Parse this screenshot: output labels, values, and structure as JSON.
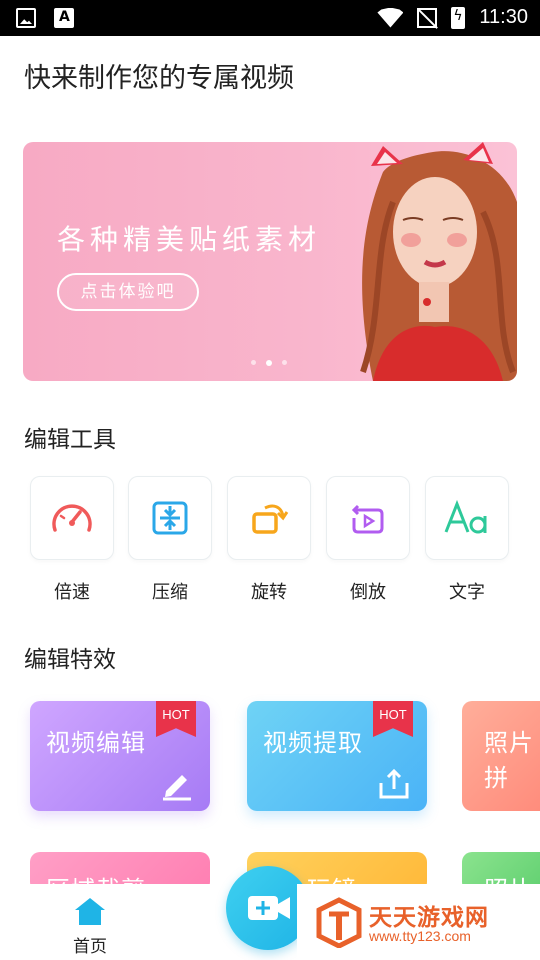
{
  "status_bar": {
    "time": "11:30",
    "icons": [
      "image-icon",
      "font-a-icon",
      "wifi-icon",
      "no-sim-icon",
      "battery-charging-icon"
    ]
  },
  "header": {
    "title": "快来制作您的专属视频"
  },
  "banner": {
    "headline": "各种精美贴纸素材",
    "button_label": "点击体验吧",
    "active_slide": 2,
    "slide_count": 3
  },
  "sections": {
    "tools_title": "编辑工具",
    "effects_title": "编辑特效"
  },
  "tools": [
    {
      "label": "倍速",
      "icon": "speed-gauge-icon",
      "color": "#f05a5a"
    },
    {
      "label": "压缩",
      "icon": "compress-icon",
      "color": "#2aa7e8"
    },
    {
      "label": "旋转",
      "icon": "rotate-icon",
      "color": "#f7a61c"
    },
    {
      "label": "倒放",
      "icon": "reverse-play-icon",
      "color": "#b15cf0"
    },
    {
      "label": "文字",
      "icon": "text-aa-icon",
      "color": "#2ec99a"
    }
  ],
  "effects": [
    {
      "label": "视频编辑",
      "hot": "HOT",
      "icon": "pencil-icon"
    },
    {
      "label": "视频提取",
      "hot": "HOT",
      "icon": "upload-icon"
    },
    {
      "label": "照片拼"
    }
  ],
  "effects_row2": [
    {
      "label": "区域裁剪"
    },
    {
      "label": "玩镜"
    },
    {
      "label": "照片"
    }
  ],
  "bottom_nav": {
    "home_label": "首页"
  },
  "watermark": {
    "title": "天天游戏网",
    "url": "www.tty123.com"
  }
}
